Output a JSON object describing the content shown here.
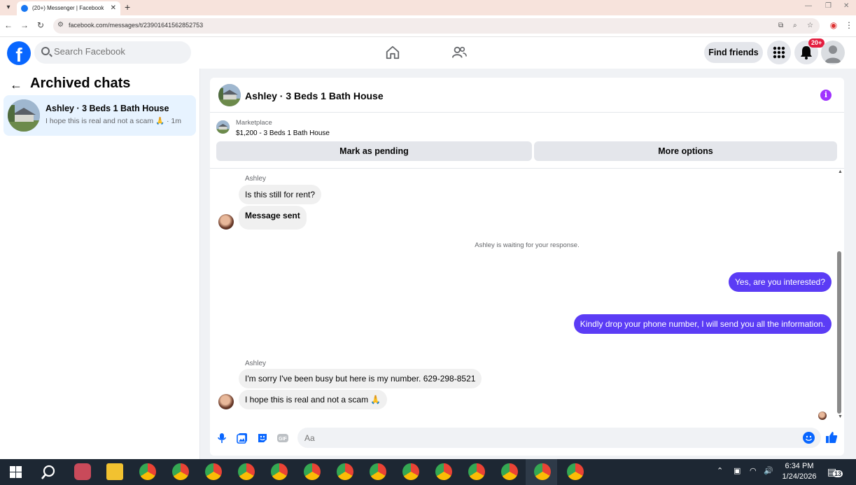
{
  "browser": {
    "tab_title": "(20+) Messenger | Facebook",
    "new_tab_symbol": "+",
    "url": "facebook.com/messages/t/23901641562852753"
  },
  "header": {
    "search_placeholder": "Search Facebook",
    "find_friends": "Find friends",
    "notification_badge": "20+"
  },
  "sidebar": {
    "title": "Archived chats",
    "chat": {
      "name": "Ashley · 3 Beds 1 Bath House",
      "preview": "I hope this is real and not a scam 🙏 · 1m"
    }
  },
  "conversation": {
    "title": "Ashley · 3 Beds 1 Bath House",
    "marketplace_label": "Marketplace",
    "listing": "$1,200 - 3 Beds 1 Bath House",
    "mark_pending": "Mark as pending",
    "more_options": "More options",
    "messages": [
      {
        "sender": "Ashley",
        "text": "Is this still for rent?",
        "dir": "in"
      },
      {
        "text": "Message sent",
        "dir": "in"
      },
      {
        "status": "Ashley is waiting for your response."
      },
      {
        "text": "Yes, are you interested?",
        "dir": "out"
      },
      {
        "text": "Kindly drop your phone number, I will send you all the information.",
        "dir": "out"
      },
      {
        "sender": "Ashley",
        "text": "I'm sorry I've been busy but here is my number.  629-298-8521",
        "dir": "in"
      },
      {
        "text": "I hope this is real and not a scam 🙏",
        "dir": "in"
      }
    ],
    "composer_placeholder": "Aa"
  },
  "taskbar": {
    "time": "6:34 PM",
    "date": "1/24/2026",
    "notifications": "13"
  },
  "colors": {
    "fb_blue": "#0866ff",
    "outgoing_bubble": "#5b3cf5",
    "selected_chat": "#e7f3ff",
    "info_purple": "#a033ff",
    "badge_red": "#e41e3f"
  },
  "icons": [
    "home-icon",
    "friends-icon",
    "menu-grid-icon",
    "bell-icon",
    "mic-icon",
    "photo-icon",
    "sticker-icon",
    "gif-icon",
    "emoji-icon",
    "like-icon",
    "info-icon",
    "search-icon"
  ]
}
